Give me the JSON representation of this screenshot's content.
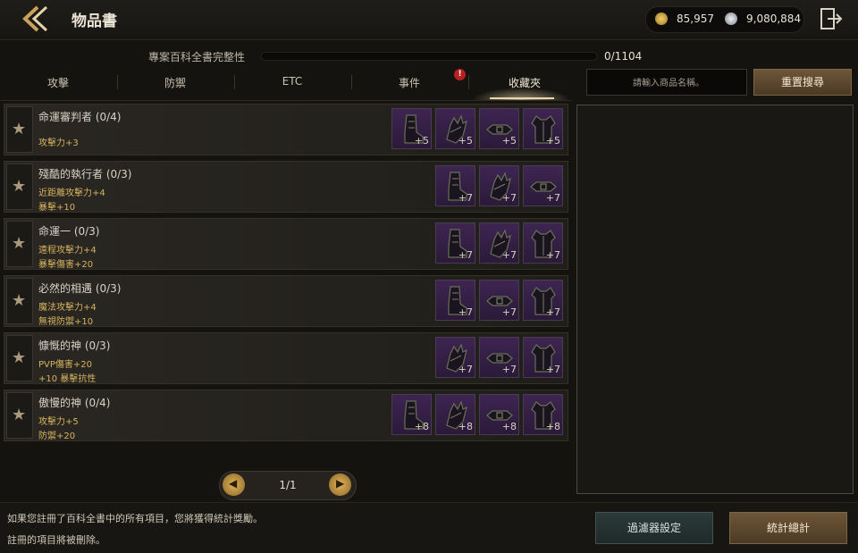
{
  "header": {
    "title": "物品書",
    "currency": [
      {
        "icon": "gold-coin-icon",
        "value": "85,957",
        "color": "#d7a843"
      },
      {
        "icon": "silver-gem-icon",
        "value": "9,080,884",
        "color": "#b9bcc2"
      }
    ]
  },
  "progress": {
    "label": "專案百科全書完整性",
    "count": "0/1104",
    "fraction": 0
  },
  "tabs": [
    {
      "label": "攻擊",
      "active": false
    },
    {
      "label": "防禦",
      "active": false
    },
    {
      "label": "ETC",
      "active": false
    },
    {
      "label": "事件",
      "active": false,
      "alert": "!"
    },
    {
      "label": "收藏夾",
      "active": true
    }
  ],
  "search": {
    "placeholder": "請輸入商品名稱。",
    "reset_label": "重置搜尋"
  },
  "sets": [
    {
      "name": "命運審判者 (0/4)",
      "bonuses": [
        "攻擊力+3"
      ],
      "items": [
        {
          "icon": "boots-icon",
          "plus": "+5"
        },
        {
          "icon": "gloves-icon",
          "plus": "+5"
        },
        {
          "icon": "belt-icon",
          "plus": "+5"
        },
        {
          "icon": "armor-icon",
          "plus": "+5"
        }
      ]
    },
    {
      "name": "殘酷的執行者 (0/3)",
      "bonuses": [
        "近距離攻擊力+4",
        "暴擊+10"
      ],
      "items": [
        {
          "icon": "boots-icon",
          "plus": "+7"
        },
        {
          "icon": "gloves-icon",
          "plus": "+7"
        },
        {
          "icon": "belt-icon",
          "plus": "+7"
        }
      ]
    },
    {
      "name": "命運一 (0/3)",
      "bonuses": [
        "遠程攻擊力+4",
        "暴擊傷害+20"
      ],
      "items": [
        {
          "icon": "boots-icon",
          "plus": "+7"
        },
        {
          "icon": "gloves-icon",
          "plus": "+7"
        },
        {
          "icon": "armor-icon",
          "plus": "+7"
        }
      ]
    },
    {
      "name": "必然的相遇 (0/3)",
      "bonuses": [
        "魔法攻擊力+4",
        "無視防禦+10"
      ],
      "items": [
        {
          "icon": "boots-icon",
          "plus": "+7"
        },
        {
          "icon": "belt-icon",
          "plus": "+7"
        },
        {
          "icon": "armor-icon",
          "plus": "+7"
        }
      ]
    },
    {
      "name": "慷慨的神 (0/3)",
      "bonuses": [
        "PVP傷害+20",
        "+10 暴擊抗性"
      ],
      "items": [
        {
          "icon": "gloves-icon",
          "plus": "+7"
        },
        {
          "icon": "belt-icon",
          "plus": "+7"
        },
        {
          "icon": "armor-icon",
          "plus": "+7"
        }
      ]
    },
    {
      "name": "傲慢的神 (0/4)",
      "bonuses": [
        "攻擊力+5",
        "防禦+20"
      ],
      "items": [
        {
          "icon": "boots-icon",
          "plus": "+8"
        },
        {
          "icon": "gloves-icon",
          "plus": "+8"
        },
        {
          "icon": "belt-icon",
          "plus": "+8"
        },
        {
          "icon": "armor-icon",
          "plus": "+8"
        }
      ]
    }
  ],
  "pager": {
    "text": "1/1"
  },
  "footer": {
    "info_lines": [
      "如果您註冊了百科全書中的所有項目，您將獲得統計獎勵。",
      "註冊的項目將被刪除。"
    ],
    "filter_label": "過濾器設定",
    "stats_label": "統計總計"
  }
}
